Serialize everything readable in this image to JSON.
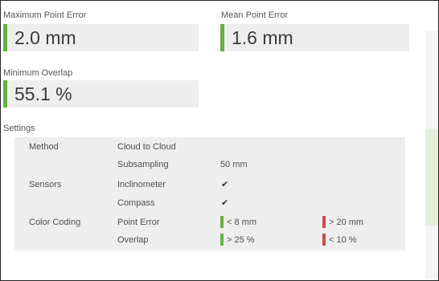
{
  "colors": {
    "good": "#63b33f",
    "bad": "#d2494d",
    "panel": "#eeeeee"
  },
  "metrics": {
    "max_point_error": {
      "label": "Maximum Point Error",
      "value": "2.0 mm"
    },
    "mean_point_error": {
      "label": "Mean Point Error",
      "value": "1.6 mm"
    },
    "min_overlap": {
      "label": "Minimum Overlap",
      "value": "55.1 %"
    }
  },
  "settings": {
    "title": "Settings",
    "method": {
      "label": "Method",
      "value": "Cloud to Cloud"
    },
    "subsampling": {
      "label": "Subsampling",
      "value": "50 mm"
    },
    "sensors": {
      "label": "Sensors",
      "inclinometer": {
        "label": "Inclinometer",
        "checked": true,
        "mark": "✔"
      },
      "compass": {
        "label": "Compass",
        "checked": true,
        "mark": "✔"
      }
    },
    "color_coding": {
      "label": "Color Coding",
      "point_error": {
        "label": "Point Error",
        "good": "< 8 mm",
        "bad": "> 20 mm"
      },
      "overlap": {
        "label": "Overlap",
        "good": "> 25 %",
        "bad": "< 10 %"
      }
    }
  }
}
